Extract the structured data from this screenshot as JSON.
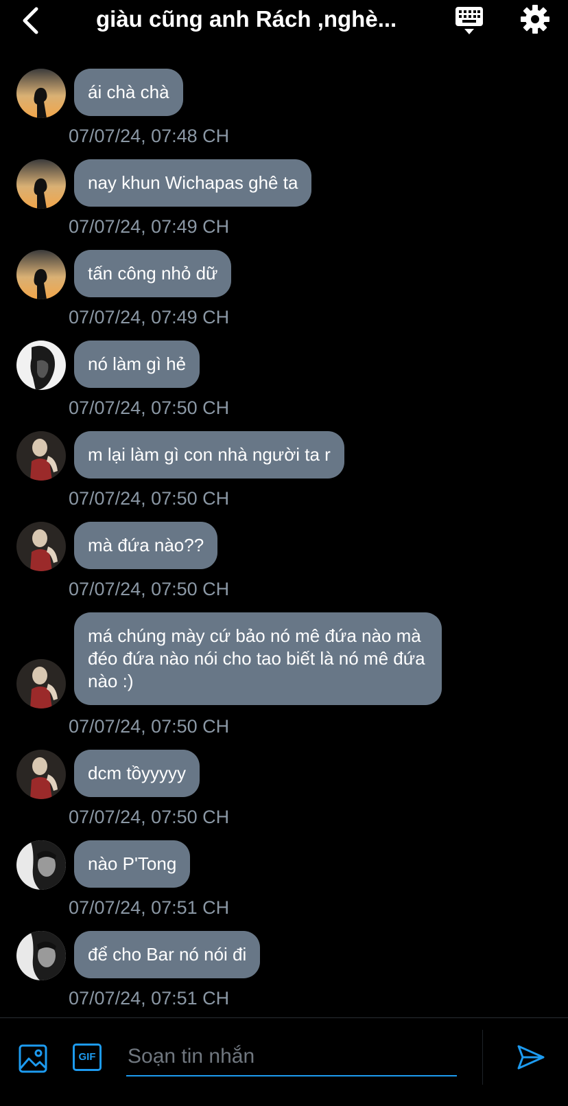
{
  "header": {
    "title": "giàu cũng anh Rách ,nghè...",
    "back_icon": "chevron-left-icon",
    "keyboard_icon": "keyboard-icon",
    "settings_icon": "gear-icon"
  },
  "messages": [
    {
      "avatar": "avatar-silhouette-sunset",
      "text": "ái chà chà",
      "time": "07/07/24, 07:48 CH"
    },
    {
      "avatar": "avatar-silhouette-sunset",
      "text": "nay khun Wichapas ghê ta",
      "time": "07/07/24, 07:49 CH"
    },
    {
      "avatar": "avatar-silhouette-sunset",
      "text": "tấn công nhỏ dữ",
      "time": "07/07/24, 07:49 CH"
    },
    {
      "avatar": "avatar-bw-portrait",
      "text": "nó làm gì hẻ",
      "time": "07/07/24, 07:50 CH"
    },
    {
      "avatar": "avatar-red-outfit",
      "text": "m lại làm gì con nhà người ta r",
      "time": "07/07/24, 07:50 CH"
    },
    {
      "avatar": "avatar-red-outfit",
      "text": "mà đứa nào??",
      "time": "07/07/24, 07:50 CH"
    },
    {
      "avatar": "avatar-red-outfit",
      "text": "má chúng mày cứ bảo nó mê đứa nào mà đéo đứa nào nói cho tao biết là nó mê đứa nào :)",
      "time": "07/07/24, 07:50 CH"
    },
    {
      "avatar": "avatar-red-outfit",
      "text": "dcm tồyyyyy",
      "time": "07/07/24, 07:50 CH"
    },
    {
      "avatar": "avatar-bw-man",
      "text": "nào P'Tong",
      "time": "07/07/24, 07:51 CH"
    },
    {
      "avatar": "avatar-bw-man",
      "text": "để cho Bar nó nói đi",
      "time": "07/07/24, 07:51 CH"
    }
  ],
  "composer": {
    "image_icon": "image-icon",
    "gif_label": "GIF",
    "placeholder": "Soạn tin nhắn",
    "send_icon": "send-icon"
  },
  "colors": {
    "background": "#000000",
    "bubble": "#687787",
    "timestamp": "#8B98A5",
    "accent": "#1D9BF0"
  }
}
